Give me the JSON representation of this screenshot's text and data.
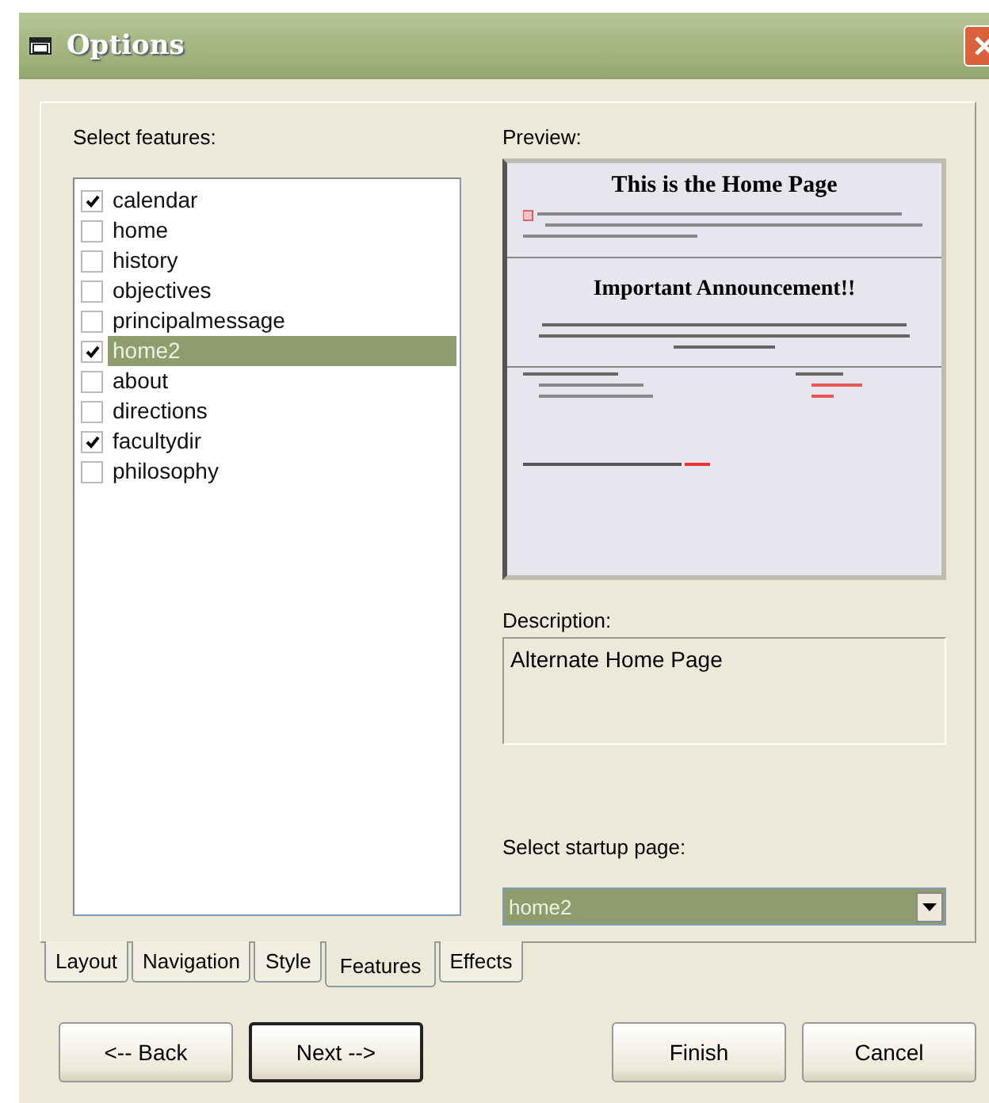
{
  "window": {
    "title": "Options"
  },
  "features": {
    "label": "Select features:",
    "items": [
      {
        "name": "calendar",
        "checked": true,
        "selected": false
      },
      {
        "name": "home",
        "checked": false,
        "selected": false
      },
      {
        "name": "history",
        "checked": false,
        "selected": false
      },
      {
        "name": "objectives",
        "checked": false,
        "selected": false
      },
      {
        "name": "principalmessage",
        "checked": false,
        "selected": false
      },
      {
        "name": "home2",
        "checked": true,
        "selected": true
      },
      {
        "name": "about",
        "checked": false,
        "selected": false
      },
      {
        "name": "directions",
        "checked": false,
        "selected": false
      },
      {
        "name": "facultydir",
        "checked": true,
        "selected": false
      },
      {
        "name": "philosophy",
        "checked": false,
        "selected": false
      }
    ]
  },
  "preview": {
    "label": "Preview:",
    "page_title": "This is the Home Page",
    "announcement_title": "Important Announcement!!"
  },
  "description": {
    "label": "Description:",
    "value": "Alternate Home Page"
  },
  "startup": {
    "label": "Select startup page:",
    "value": "home2"
  },
  "tabs": [
    {
      "label": "Layout",
      "selected": false
    },
    {
      "label": "Navigation",
      "selected": false
    },
    {
      "label": "Style",
      "selected": false
    },
    {
      "label": "Features",
      "selected": true
    },
    {
      "label": "Effects",
      "selected": false
    }
  ],
  "buttons": [
    {
      "label": "<-- Back",
      "kind": "left",
      "default": false
    },
    {
      "label": "Next -->",
      "kind": "left",
      "default": true
    },
    {
      "label": "Finish",
      "kind": "right",
      "default": false
    },
    {
      "label": "Cancel",
      "kind": "right",
      "default": false
    }
  ]
}
